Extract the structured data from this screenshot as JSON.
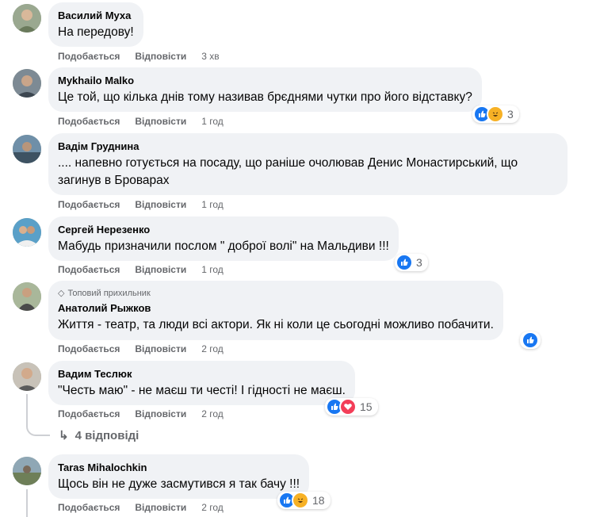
{
  "comments": [
    {
      "author": "Василий Муха",
      "text": "На передову!",
      "like": "Подобається",
      "reply": "Відповісти",
      "time": "3 хв"
    },
    {
      "author": "Mykhailo Malko",
      "text": "Це той, що кілька днів тому називав брєднями чутки про його відставку?",
      "like": "Подобається",
      "reply": "Відповісти",
      "time": "1 год",
      "reactions_count": "3"
    },
    {
      "author": "Вадім Груднина",
      "text": ".... напевно готується на посаду, що раніше очолював Денис Монастирський, що загинув в Броварах",
      "like": "Подобається",
      "reply": "Відповісти",
      "time": "1 год"
    },
    {
      "author": "Сергей Нерезенко",
      "text": "Мабудь призначили послом \" доброї волі\" на Мальдиви !!!",
      "like": "Подобається",
      "reply": "Відповісти",
      "time": "1 год",
      "reactions_count": "3"
    },
    {
      "author": "Анатолий Рыжков",
      "badge": "Топовий прихильник",
      "text": "Життя - театр, та люди всі актори. Як ні коли це сьогодні можливо побачити.",
      "like": "Подобається",
      "reply": "Відповісти",
      "time": "2 год"
    },
    {
      "author": "Вадим Теслюк",
      "text": "\"Честь маю\" - не маєш ти честі! І гідності не маєш.",
      "like": "Подобається",
      "reply": "Відповісти",
      "time": "2 год",
      "reactions_count": "15"
    },
    {
      "author": "Taras Mihalochkin",
      "text": "Щось він не дуже засмутився я так бачу !!!",
      "like": "Подобається",
      "reply": "Відповісти",
      "time": "2 год",
      "reactions_count": "18"
    }
  ],
  "replies_link": "4 відповіді",
  "colors": {
    "like": "#1877f2",
    "love": "#f33e58",
    "haha": "#f7b125",
    "bubble": "#f0f2f5",
    "meta": "#65676b"
  },
  "icons": {
    "like": "thumbs-up-icon",
    "love": "heart-icon",
    "haha": "laughing-face-icon",
    "badge": "diamond-icon",
    "replies": "reply-arrow-icon"
  }
}
